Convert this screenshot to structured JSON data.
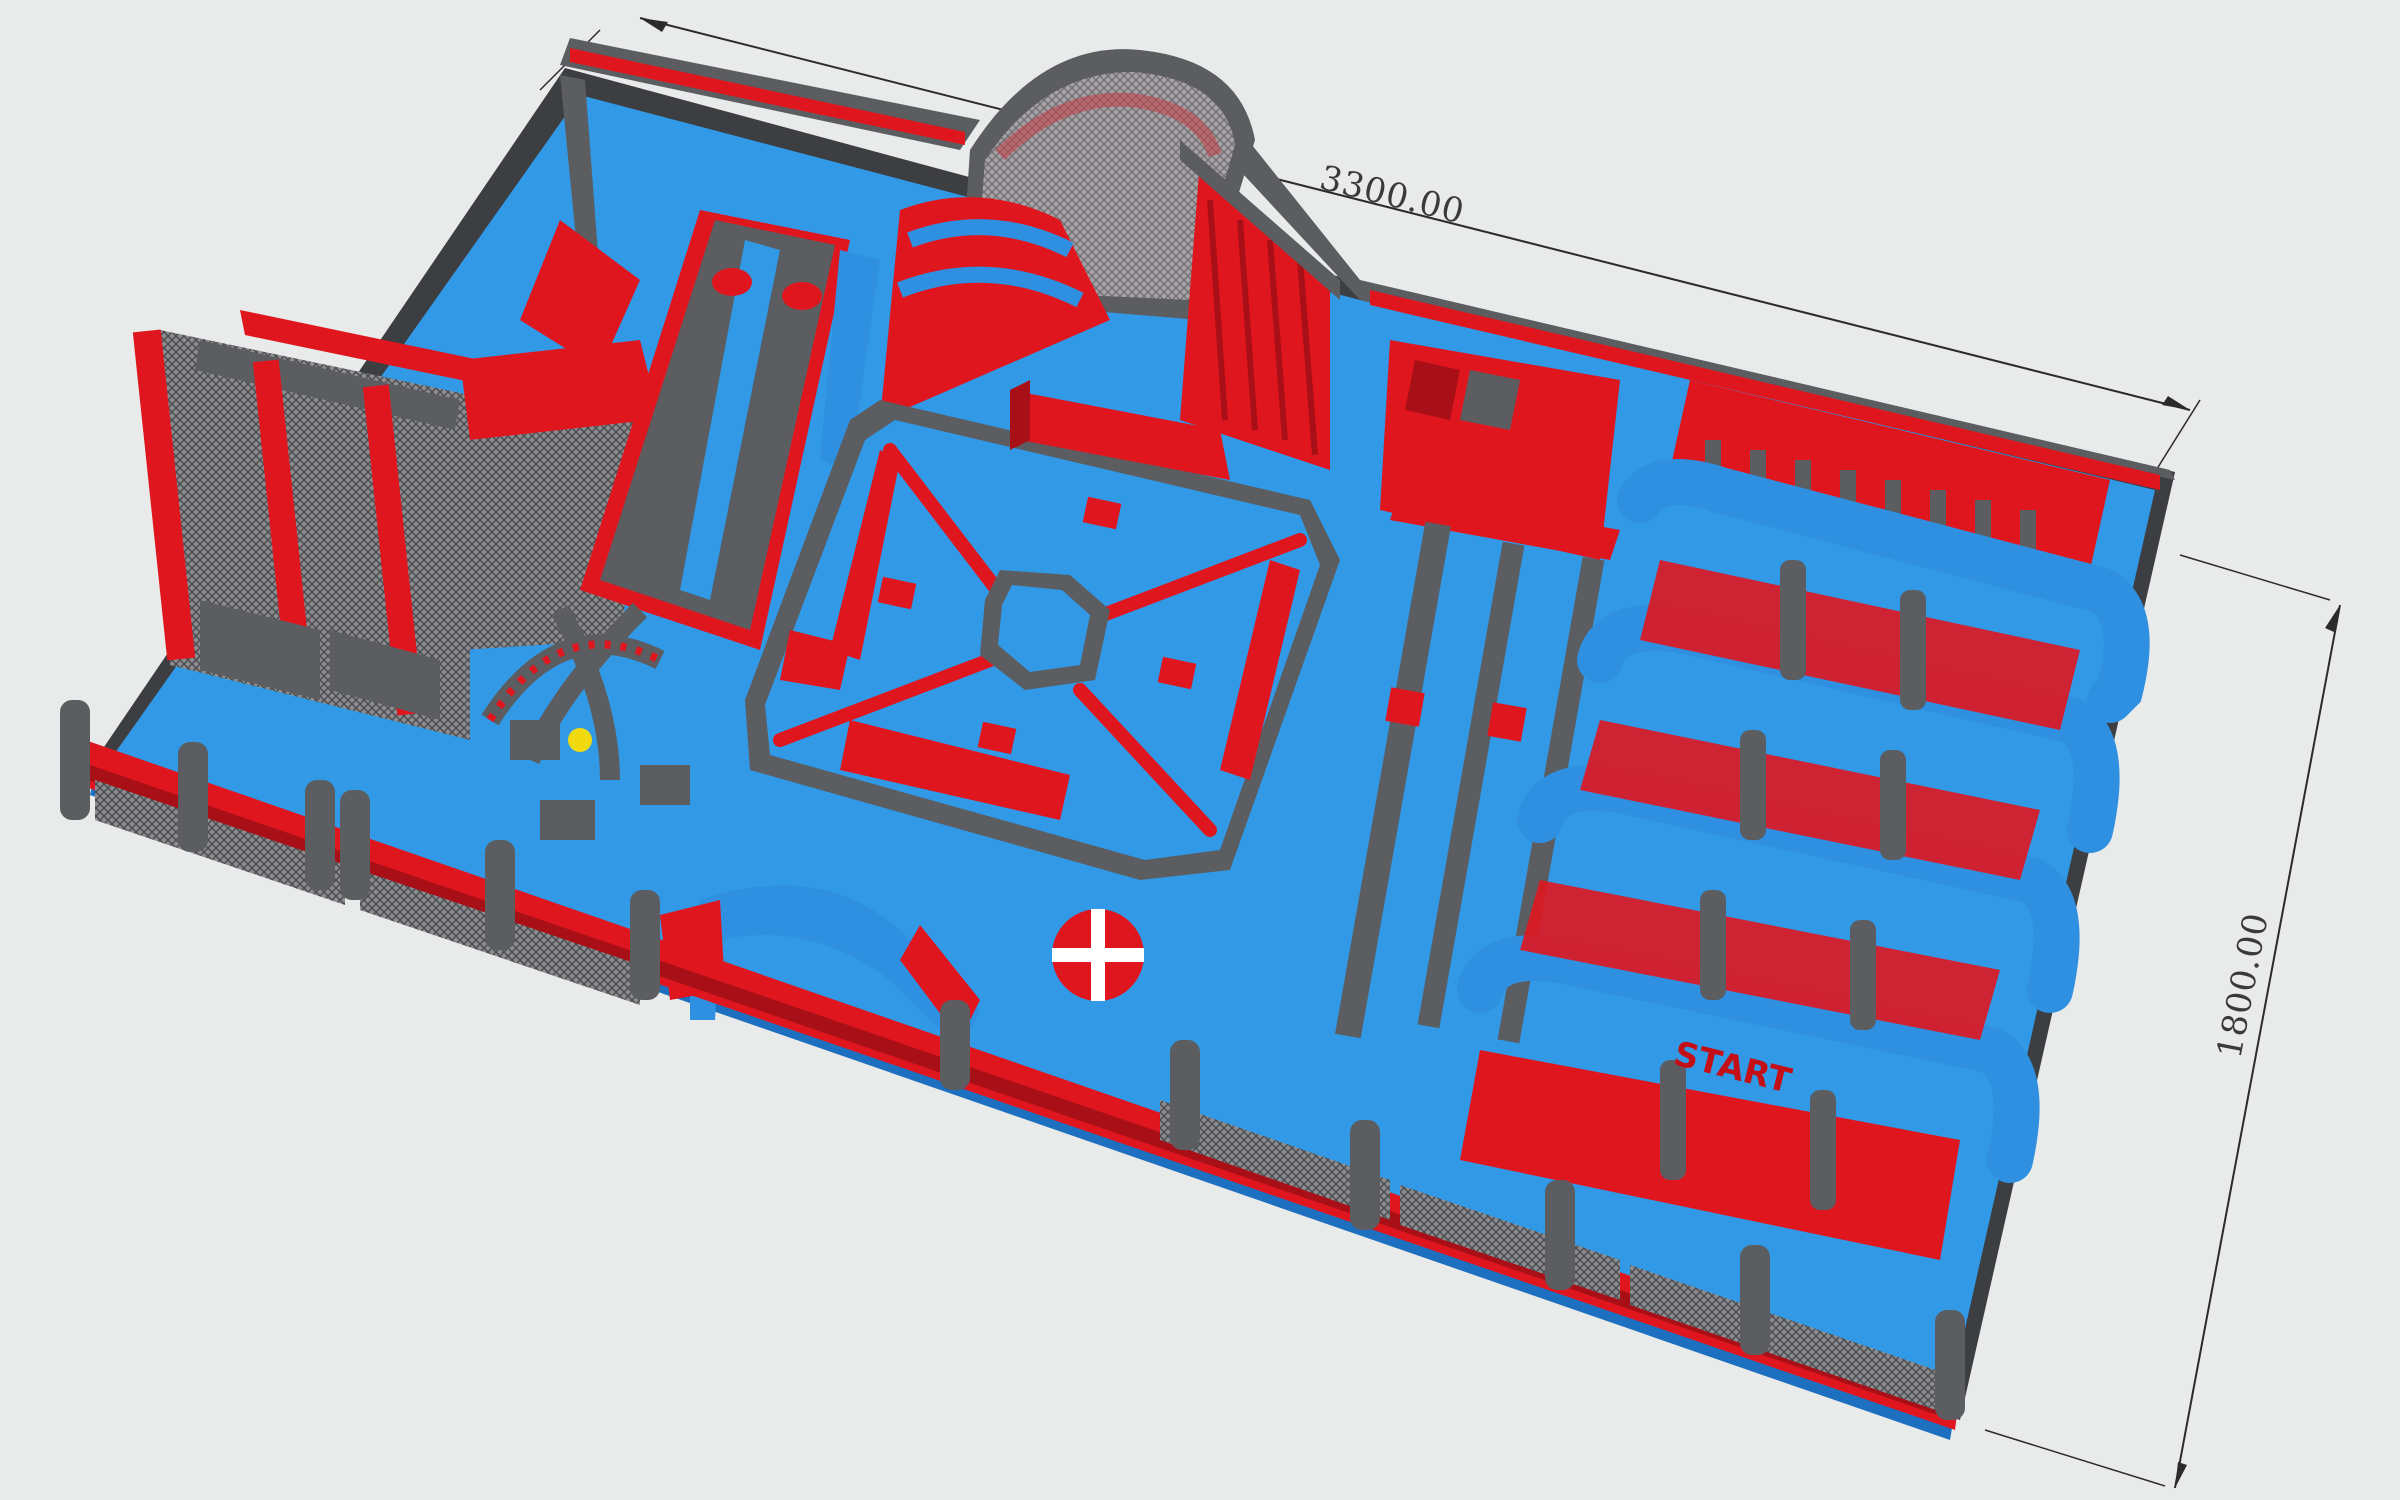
{
  "scene": {
    "subject": "inflatable-park",
    "palette": {
      "blue": "#2f8fe0",
      "blue_dark": "#1d6fc0",
      "red": "#e0161f",
      "red_dark": "#a80f16",
      "grey": "#5b5d61",
      "grey_dark": "#3d3e42",
      "floor": "#3199e6",
      "background": "#e9eaea"
    }
  },
  "dimensions": {
    "length_label": "3300.00",
    "width_label": "1800.00"
  },
  "labels": {
    "start_sign": "START"
  }
}
